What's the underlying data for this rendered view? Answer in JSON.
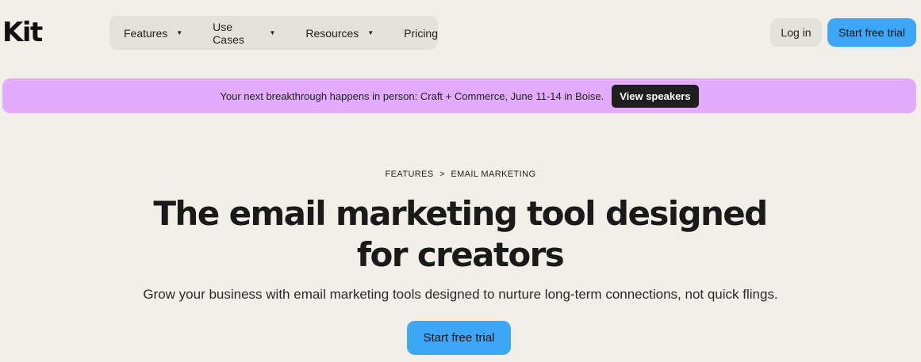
{
  "brand": {
    "logo_text": "Kit"
  },
  "nav": {
    "items": [
      {
        "label": "Features",
        "caret": "▼"
      },
      {
        "label": "Use Cases",
        "caret": "▼"
      },
      {
        "label": "Resources",
        "caret": "▼"
      },
      {
        "label": "Pricing"
      }
    ]
  },
  "header": {
    "login_label": "Log in",
    "trial_label": "Start free trial"
  },
  "banner": {
    "text": "Your next breakthrough happens in person: Craft + Commerce, June 11-14 in Boise.",
    "button_label": "View speakers"
  },
  "breadcrumb": {
    "items": [
      "FEATURES",
      "EMAIL MARKETING"
    ],
    "separator": ">"
  },
  "hero": {
    "title": "The email marketing tool designed for creators",
    "subtitle": "Grow your business with email marketing tools designed to nurture long-term connections, not quick flings.",
    "cta_label": "Start free trial"
  },
  "colors": {
    "background": "#f2efe8",
    "nav_bg": "#e4e1da",
    "accent_blue": "#3ea7f5",
    "banner_purple": "#e2abfb",
    "dark_button": "#1f1f1f"
  }
}
